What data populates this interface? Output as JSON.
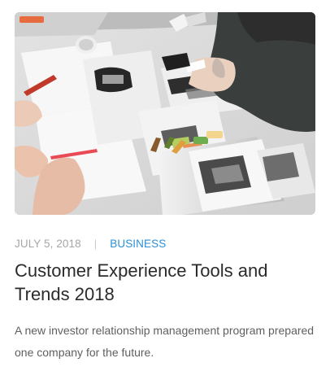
{
  "post": {
    "date": "JULY 5, 2018",
    "separator": "|",
    "category": "BUSINESS",
    "title": "Customer Experience Tools and Trends 2018",
    "excerpt": "A new investor relationship management program prepared one company for the future.",
    "image_icon": "photo-icon"
  },
  "colors": {
    "category": "#2b8fd6",
    "date": "#a6a6a6",
    "title": "#2b2b2b",
    "excerpt": "#5f5f5f"
  }
}
